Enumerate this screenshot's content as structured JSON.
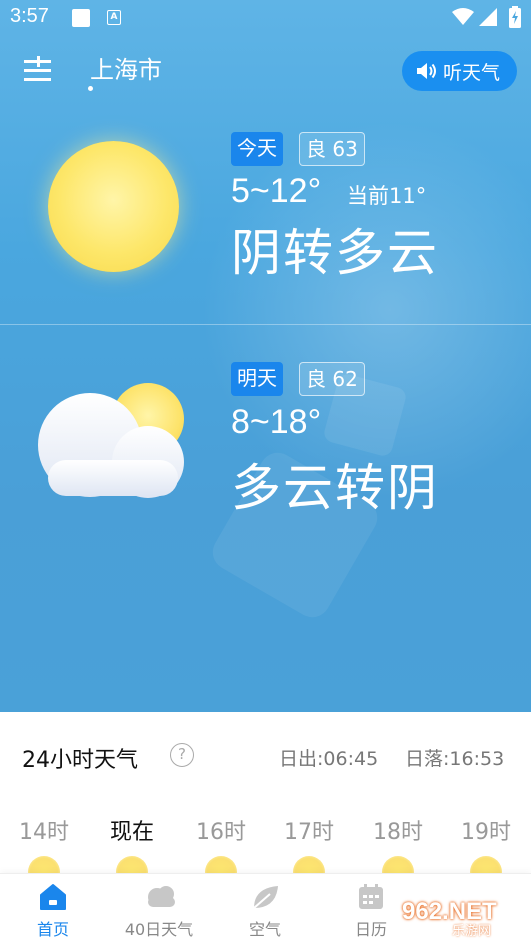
{
  "status_bar": {
    "time": "3:57",
    "app_badge": "A"
  },
  "header": {
    "city": "上海市",
    "listen_label": "听天气"
  },
  "today": {
    "day_label": "今天",
    "aqi_label": "良 63",
    "range": "5~12°",
    "current": "当前11°",
    "condition": "阴转多云",
    "icon": "sun-icon"
  },
  "tomorrow": {
    "day_label": "明天",
    "aqi_label": "良 62",
    "range": "8~18°",
    "condition": "多云转阴",
    "icon": "partly-cloudy-icon"
  },
  "hourly": {
    "title": "24小时天气",
    "help": "?",
    "sunrise": "日出:06:45",
    "sunset": "日落:16:53",
    "hours": [
      "14时",
      "现在",
      "16时",
      "17时",
      "18时",
      "19时"
    ]
  },
  "nav": {
    "items": [
      {
        "label": "首页",
        "icon": "home-icon",
        "active": true
      },
      {
        "label": "40日天气",
        "icon": "cloud-icon",
        "active": false
      },
      {
        "label": "空气",
        "icon": "leaf-icon",
        "active": false
      },
      {
        "label": "日历",
        "icon": "calendar-icon",
        "active": false
      }
    ]
  },
  "watermark": {
    "text": "962.NET",
    "sub": "乐游网"
  },
  "colors": {
    "sky": "#4aa7df",
    "accent": "#1a86ec",
    "sun": "#fde76a"
  }
}
